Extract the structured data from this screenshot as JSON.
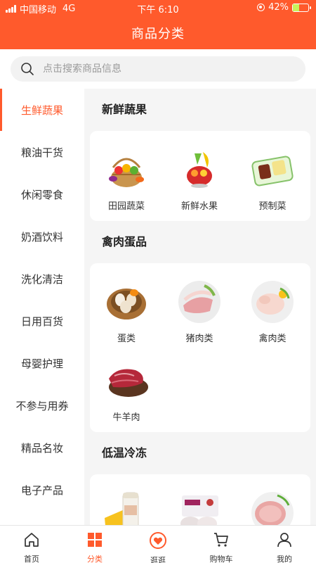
{
  "status_bar": {
    "carrier": "中国移动",
    "network": "4G",
    "time": "下午 6:10",
    "battery": "42%",
    "battery_level": 0.42
  },
  "header": {
    "title": "商品分类"
  },
  "search": {
    "placeholder": "点击搜索商品信息"
  },
  "sidebar": {
    "items": [
      {
        "label": "生鲜蔬果",
        "active": true
      },
      {
        "label": "粮油干货"
      },
      {
        "label": "休闲零食"
      },
      {
        "label": "奶酒饮料"
      },
      {
        "label": "洗化清洁"
      },
      {
        "label": "日用百货"
      },
      {
        "label": "母婴护理"
      },
      {
        "label": "不参与用券"
      },
      {
        "label": "精品名妆"
      },
      {
        "label": "电子产品"
      }
    ]
  },
  "sections": [
    {
      "title": "新鲜蔬果",
      "items": [
        {
          "label": "田园蔬菜",
          "icon": "vegetable-basket-icon"
        },
        {
          "label": "新鲜水果",
          "icon": "fruit-platter-icon"
        },
        {
          "label": "预制菜",
          "icon": "prepared-dish-icon"
        }
      ]
    },
    {
      "title": "禽肉蛋品",
      "items": [
        {
          "label": "蛋类",
          "icon": "egg-basket-icon"
        },
        {
          "label": "猪肉类",
          "icon": "pork-slices-icon"
        },
        {
          "label": "禽肉类",
          "icon": "poultry-icon"
        },
        {
          "label": "牛羊肉",
          "icon": "beef-steak-icon"
        }
      ]
    },
    {
      "title": "低温冷冻",
      "items": [
        {
          "label": "",
          "icon": "yogurt-cheese-icon"
        },
        {
          "label": "",
          "icon": "frozen-dumplings-icon"
        },
        {
          "label": "",
          "icon": "ham-slices-icon"
        }
      ]
    }
  ],
  "bottom_nav": {
    "items": [
      {
        "label": "首页",
        "icon": "home-icon"
      },
      {
        "label": "分类",
        "icon": "category-grid-icon",
        "active": true
      },
      {
        "label": "逛逛",
        "icon": "heart-bag-icon"
      },
      {
        "label": "购物车",
        "icon": "cart-icon"
      },
      {
        "label": "我的",
        "icon": "user-icon"
      }
    ]
  },
  "colors": {
    "accent": "#ff5a2c",
    "content_bg": "#f5f5f5",
    "battery_fill": "#c8f25a"
  }
}
